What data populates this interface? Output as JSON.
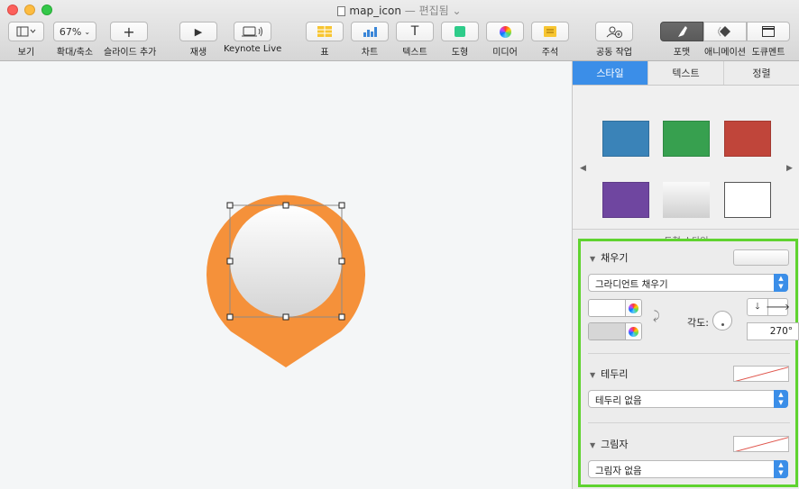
{
  "window": {
    "filename": "map_icon",
    "status": "— 편집됨 ⌄"
  },
  "toolbar": {
    "view": {
      "label": "보기"
    },
    "zoom": {
      "value": "67%",
      "label": "확대/축소"
    },
    "add_slide": {
      "label": "슬라이드 추가"
    },
    "play": {
      "label": "재생"
    },
    "keynote_live": {
      "label": "Keynote Live"
    },
    "table": {
      "label": "표"
    },
    "chart": {
      "label": "차트"
    },
    "text": {
      "label": "텍스트"
    },
    "shape": {
      "label": "도형"
    },
    "media": {
      "label": "미디어"
    },
    "comment": {
      "label": "주석"
    },
    "collaborate": {
      "label": "공동 작업"
    },
    "format": {
      "label": "포맷"
    },
    "animate": {
      "label": "애니메이션"
    },
    "document": {
      "label": "도큐멘트"
    }
  },
  "inspector": {
    "tabs": [
      "스타일",
      "텍스트",
      "정렬"
    ],
    "active_tab": "스타일",
    "shape_styles": {
      "caption": "도형 스타일",
      "swatches": [
        "#3a83b8",
        "#37a04f",
        "#c0453a",
        "#6f46a0",
        "#e6e6e6",
        "#ffffff"
      ]
    },
    "fill": {
      "title": "채우기",
      "type": "그라디언트 채우기",
      "color1": "#ffffff",
      "color2": "#d6d6d6",
      "angle_label": "각도:",
      "angle_value": "270°"
    },
    "border": {
      "title": "테두리",
      "type": "테두리 없음"
    },
    "shadow": {
      "title": "그림자",
      "type": "그림자 없음"
    }
  },
  "canvas": {
    "pin_color": "#f5913a",
    "circle_gradient_top": "#ffffff",
    "circle_gradient_bottom": "#d4d4d4"
  }
}
